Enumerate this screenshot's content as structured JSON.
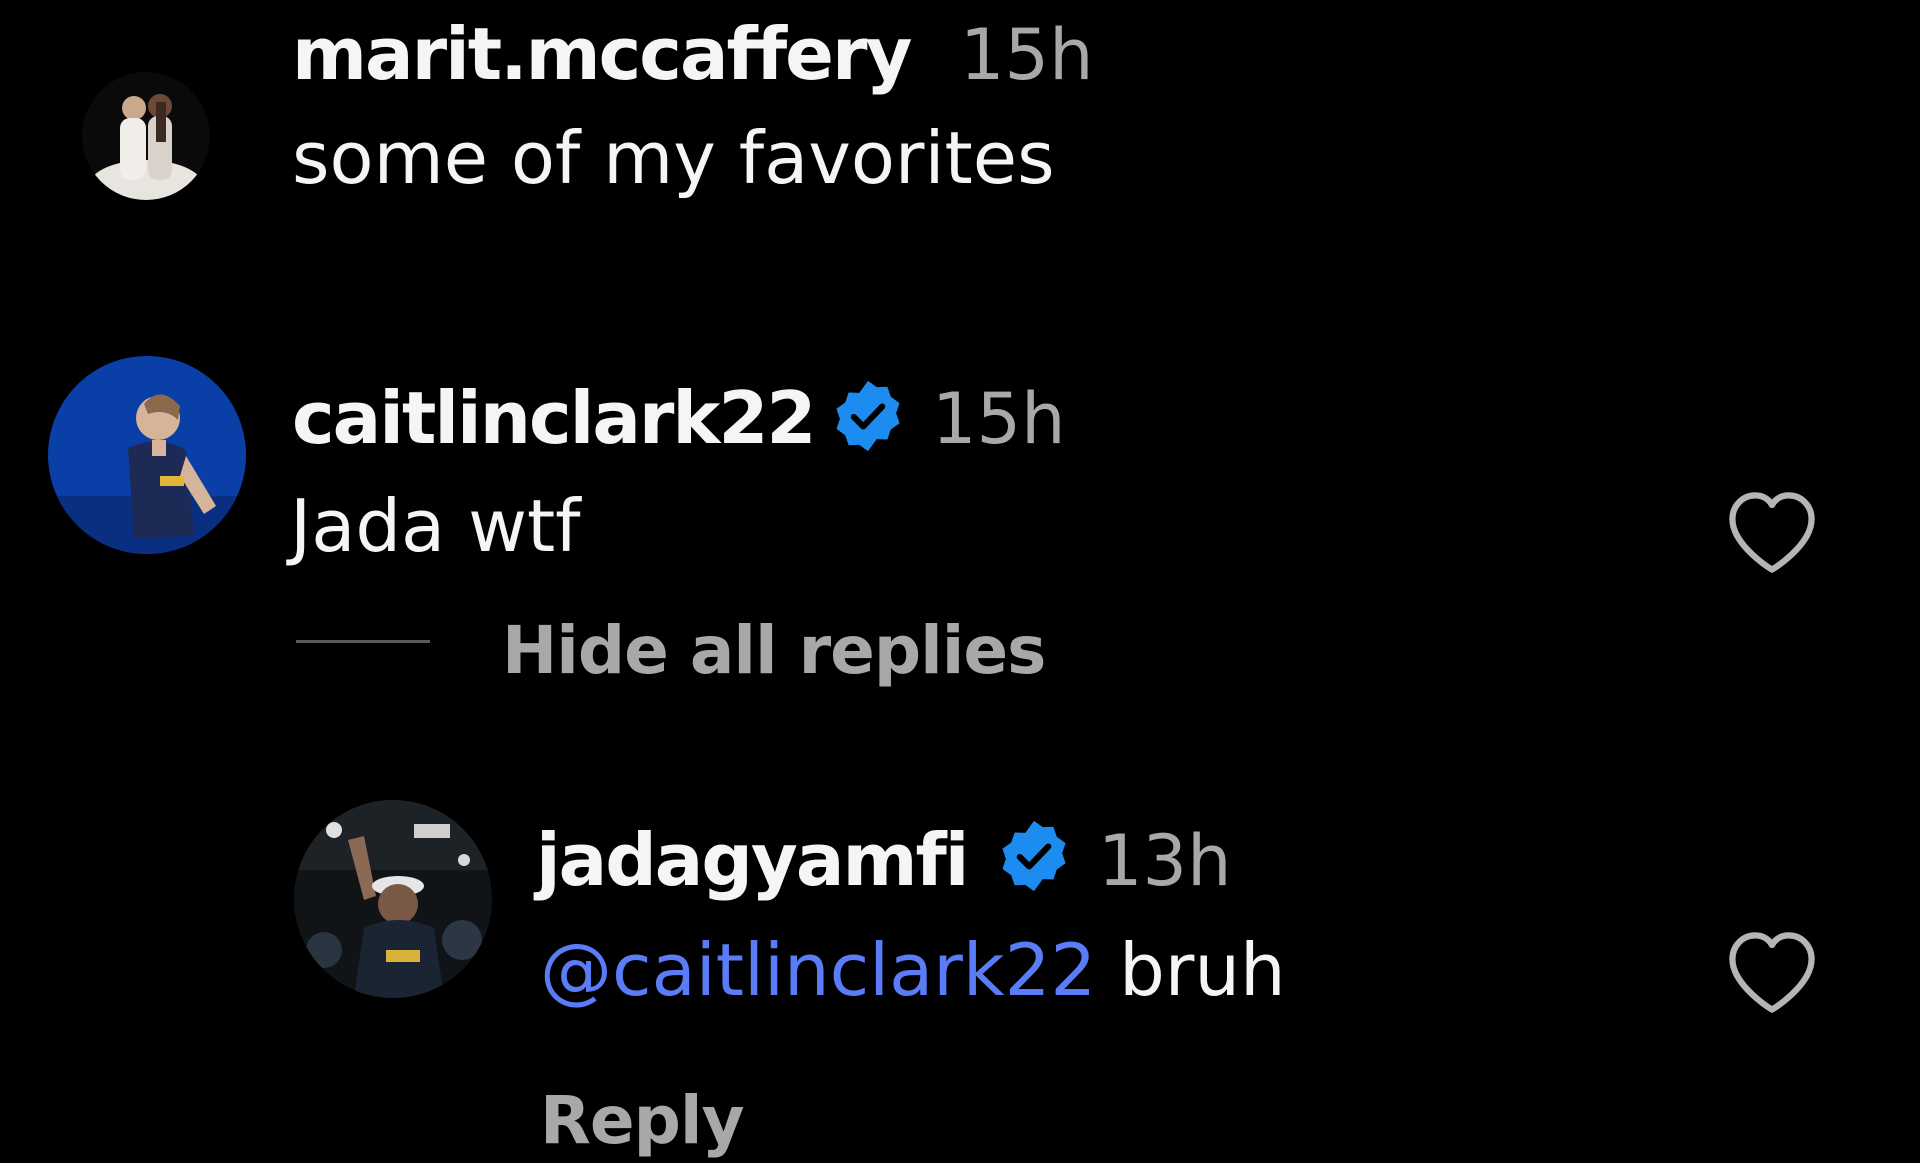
{
  "comments": [
    {
      "username": "marit.mccaffery",
      "time": "15h",
      "text": "some of my favorites",
      "verified": false
    },
    {
      "username": "caitlinclark22",
      "time": "15h",
      "text": "Jada wtf",
      "verified": true,
      "toggle_replies_label": "Hide all replies",
      "replies": [
        {
          "username": "jadagyamfi",
          "time": "13h",
          "mention": "@caitlinclark22",
          "text": " bruh",
          "verified": true,
          "reply_label": "Reply"
        }
      ]
    }
  ],
  "icons": {
    "like": "heart-outline-icon",
    "verified": "verified-badge-icon"
  },
  "colors": {
    "background": "#000000",
    "text": "#f5f5f5",
    "muted": "#a8a8a8",
    "mention": "#5b7cf7",
    "verified": "#1d8cf0"
  }
}
